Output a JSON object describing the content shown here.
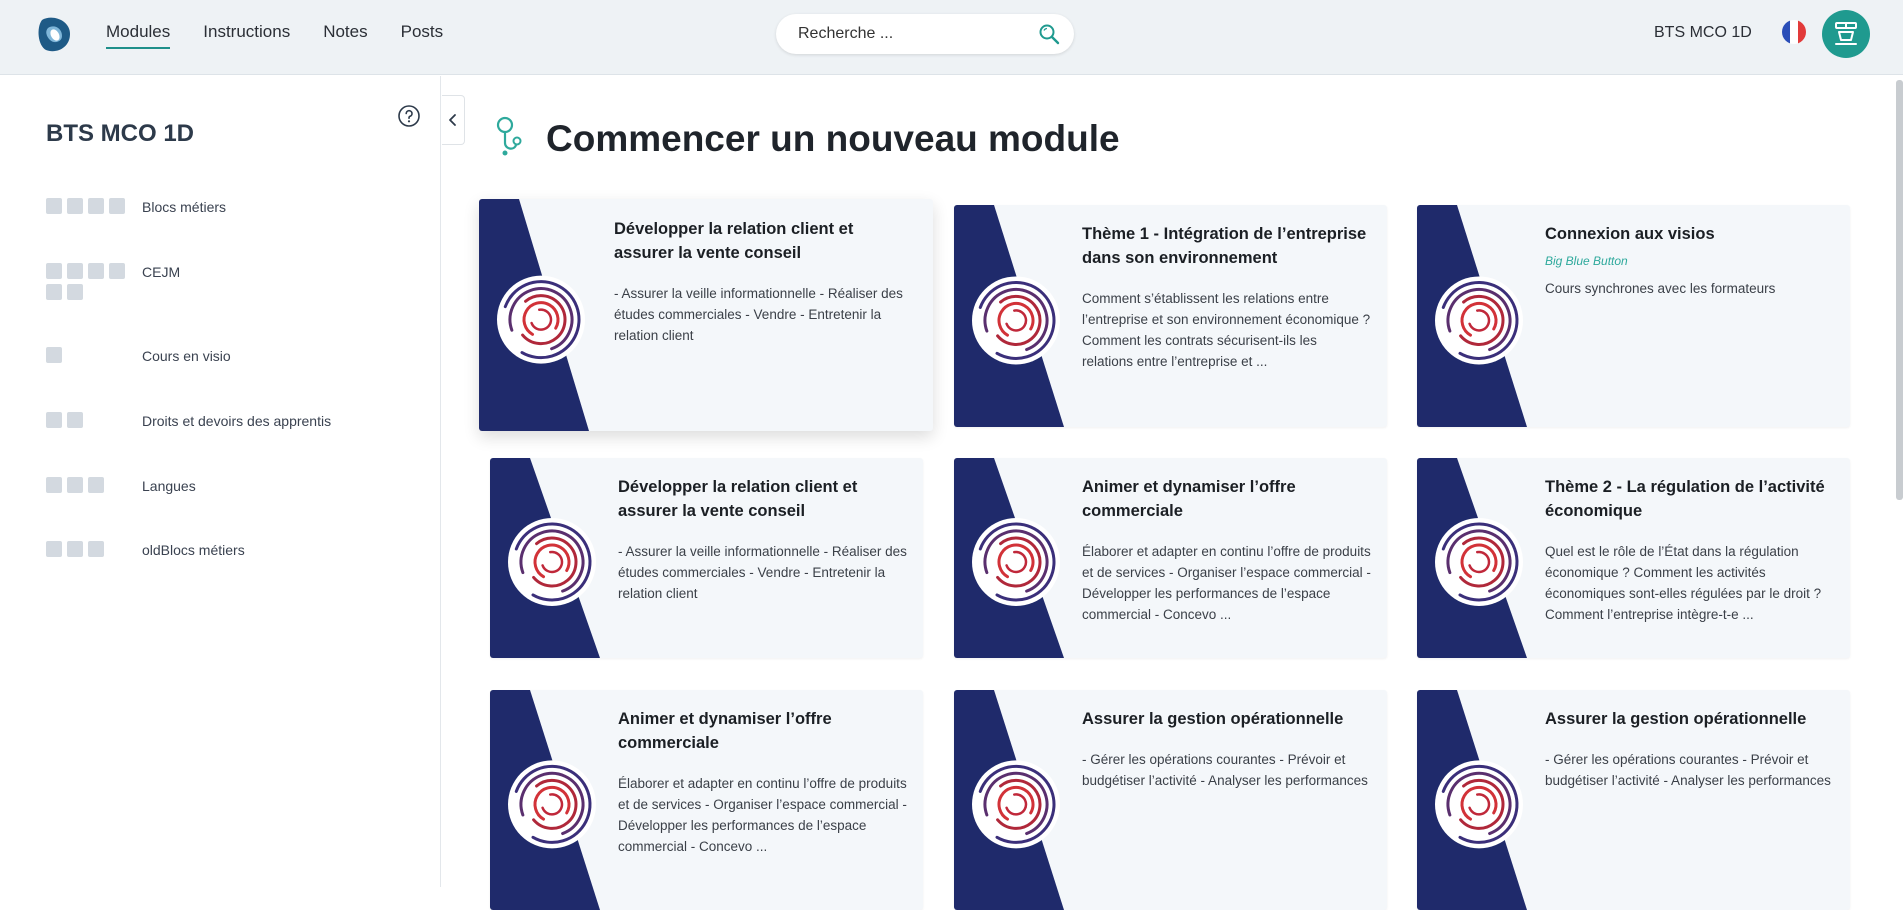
{
  "header": {
    "nav": [
      {
        "label": "Modules"
      },
      {
        "label": "Instructions"
      },
      {
        "label": "Notes"
      },
      {
        "label": "Posts"
      }
    ],
    "search_placeholder": "Recherche ...",
    "org_name": "BTS MCO 1D",
    "flag_colors": [
      "#2a4eb8",
      "#ffffff",
      "#e23a3a"
    ],
    "avatar_color": "#1f9a8f"
  },
  "sidebar": {
    "title": "BTS MCO 1D",
    "items": [
      {
        "label": "Blocs métiers",
        "squares": 4
      },
      {
        "label": "CEJM",
        "squares": 6
      },
      {
        "label": "Cours en visio",
        "squares": 1
      },
      {
        "label": "Droits et devoirs des apprentis",
        "squares": 2
      },
      {
        "label": "Langues",
        "squares": 3
      },
      {
        "label": "oldBlocs métiers",
        "squares": 3
      }
    ]
  },
  "main": {
    "title": "Commencer un nouveau module",
    "accent_color": "#2ea99c",
    "art_color": "#1f2a6b",
    "cards": [
      {
        "title": "Développer la relation client et assurer la vente conseil",
        "subtitle": "",
        "description": "- Assurer la veille informationnelle - Réaliser des études commerciales - Vendre - Entretenir la relation client"
      },
      {
        "title": "Thème 1 - Intégration de l’entreprise dans son environnement",
        "subtitle": "",
        "description": "Comment s’établissent les relations entre l’entreprise et son environnement économique ? Comment les contrats sécurisent-ils les relations entre l’entreprise et ..."
      },
      {
        "title": "Connexion aux visios",
        "subtitle": "Big Blue Button",
        "description": "Cours synchrones avec les formateurs"
      },
      {
        "title": "Développer la relation client et assurer la vente conseil",
        "subtitle": "",
        "description": "- Assurer la veille informationnelle - Réaliser des études commerciales - Vendre - Entretenir la relation client"
      },
      {
        "title": "Animer et dynamiser l’offre commerciale",
        "subtitle": "",
        "description": "Élaborer et adapter en continu l’offre de produits et de services - Organiser l’espace commercial - Développer les performances de l’espace commercial - Concevo ..."
      },
      {
        "title": "Thème 2 - La régulation de l’activité économique",
        "subtitle": "",
        "description": "Quel est le rôle de l’État dans la régulation économique ? Comment les activités économiques sont-elles régulées par le droit ? Comment l’entreprise intègre-t-e ..."
      },
      {
        "title": "Animer et dynamiser l’offre commerciale",
        "subtitle": "",
        "description": "Élaborer et adapter en continu l’offre de produits et de services - Organiser l’espace commercial - Développer les performances de l’espace commercial - Concevo ..."
      },
      {
        "title": "Assurer la gestion opérationnelle",
        "subtitle": "",
        "description": "- Gérer les opérations courantes - Prévoir et budgétiser l’activité - Analyser les performances"
      },
      {
        "title": "Assurer la gestion opérationnelle",
        "subtitle": "",
        "description": "- Gérer les opérations courantes - Prévoir et budgétiser l’activité - Analyser les performances"
      }
    ]
  }
}
